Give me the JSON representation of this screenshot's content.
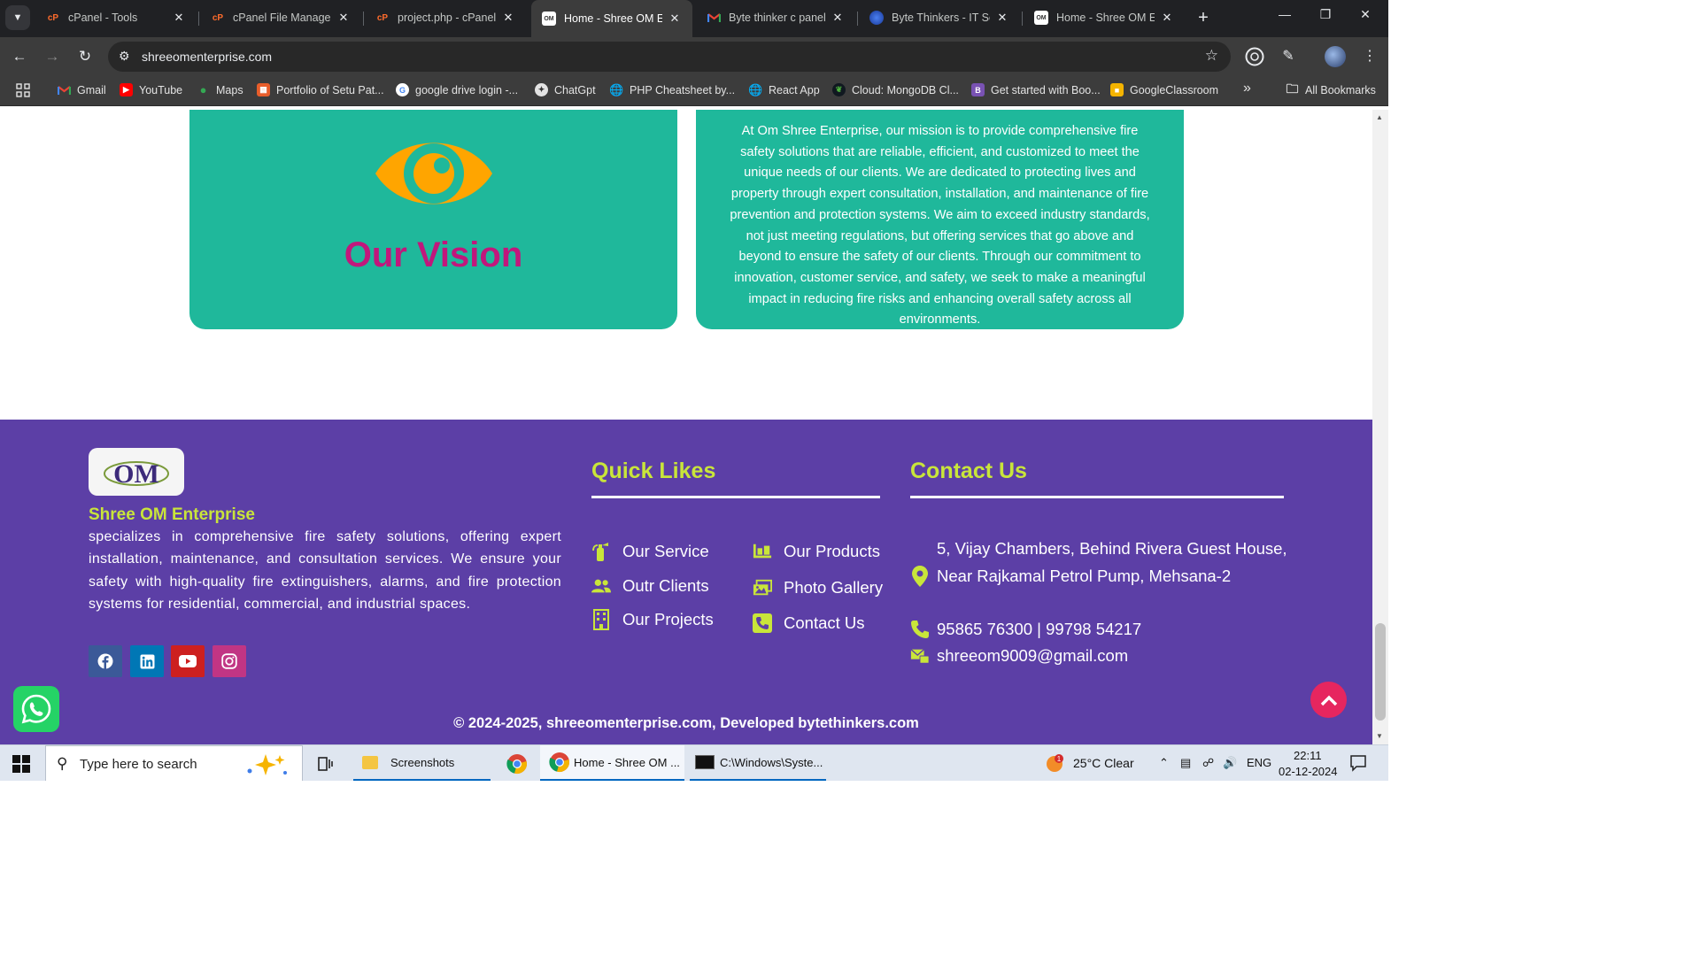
{
  "browser": {
    "tabs": [
      {
        "title": "cPanel - Tools",
        "icon": "cpanel-icon"
      },
      {
        "title": "cPanel File Manager",
        "icon": "cpanel-icon"
      },
      {
        "title": "project.php - cPanel F",
        "icon": "cpanel-icon"
      },
      {
        "title": "Home - Shree OM En",
        "icon": "om-favicon",
        "active": true
      },
      {
        "title": "Byte thinker c panel",
        "icon": "gmail-icon"
      },
      {
        "title": "Byte Thinkers - IT Ser",
        "icon": "bytethinkers-icon"
      },
      {
        "title": "Home - Shree OM En",
        "icon": "om-favicon"
      }
    ],
    "url": "shreeomenterprise.com",
    "bookmarks": [
      {
        "label": "Gmail"
      },
      {
        "label": "YouTube"
      },
      {
        "label": "Maps"
      },
      {
        "label": "Portfolio of Setu Pat..."
      },
      {
        "label": "google drive login -..."
      },
      {
        "label": "ChatGpt"
      },
      {
        "label": "PHP Cheatsheet by..."
      },
      {
        "label": "React App"
      },
      {
        "label": "Cloud: MongoDB Cl..."
      },
      {
        "label": "Get started with Boo..."
      },
      {
        "label": "GoogleClassroom"
      }
    ],
    "all_bookmarks": "All Bookmarks",
    "overflow": "»"
  },
  "vision": {
    "title": "Our Vision",
    "mission_text": "At Om Shree Enterprise, our mission is to provide comprehensive fire safety solutions that are reliable, efficient, and customized to meet the unique needs of our clients. We are dedicated to protecting lives and property through expert consultation, installation, and maintenance of fire prevention and protection systems. We aim to exceed industry standards, not just meeting regulations, but offering services that go above and beyond to ensure the safety of our clients. Through our commitment to innovation, customer service, and safety, we seek to make a meaningful impact in reducing fire risks and enhancing overall safety across all environments."
  },
  "footer": {
    "company_name": "Shree OM Enterprise",
    "description": "specializes in comprehensive fire safety solutions, offering expert installation, maintenance, and consultation services. We ensure your safety with high-quality fire extinguishers, alarms, and fire protection systems for residential, commercial, and industrial spaces.",
    "quick_title": "Quick Likes",
    "quick_links": [
      {
        "label": "Our Service",
        "icon": "fire-extinguisher-icon"
      },
      {
        "label": "Outr Clients",
        "icon": "users-icon"
      },
      {
        "label": "Our Projects",
        "icon": "building-icon"
      },
      {
        "label": "Our Products",
        "icon": "products-icon"
      },
      {
        "label": "Photo Gallery",
        "icon": "images-icon"
      },
      {
        "label": "Contact Us",
        "icon": "phone-square-icon"
      }
    ],
    "contact_title": "Contact Us",
    "address": "5, Vijay Chambers, Behind Rivera Guest House, Near Rajkamal Petrol Pump, Mehsana-2",
    "phone": "95865 76300 | 99798 54217",
    "email": "shreeom9009@gmail.com",
    "copyright": "© 2024-2025, shreeomenterprise.com, Developed bytethinkers.com",
    "colors": {
      "accent": "#c9e53a",
      "footer_bg": "#5c3fa6",
      "card": "#1fb89b",
      "vision_title": "#c1177c",
      "eye": "#ffa500"
    }
  },
  "taskbar": {
    "search_placeholder": "Type here to search",
    "items": [
      {
        "label": "Screenshots"
      },
      {
        "label": "Home - Shree OM ..."
      },
      {
        "label": "C:\\Windows\\Syste..."
      }
    ],
    "weather": "25°C  Clear",
    "lang": "ENG",
    "time": "22:11",
    "date": "02-12-2024"
  }
}
